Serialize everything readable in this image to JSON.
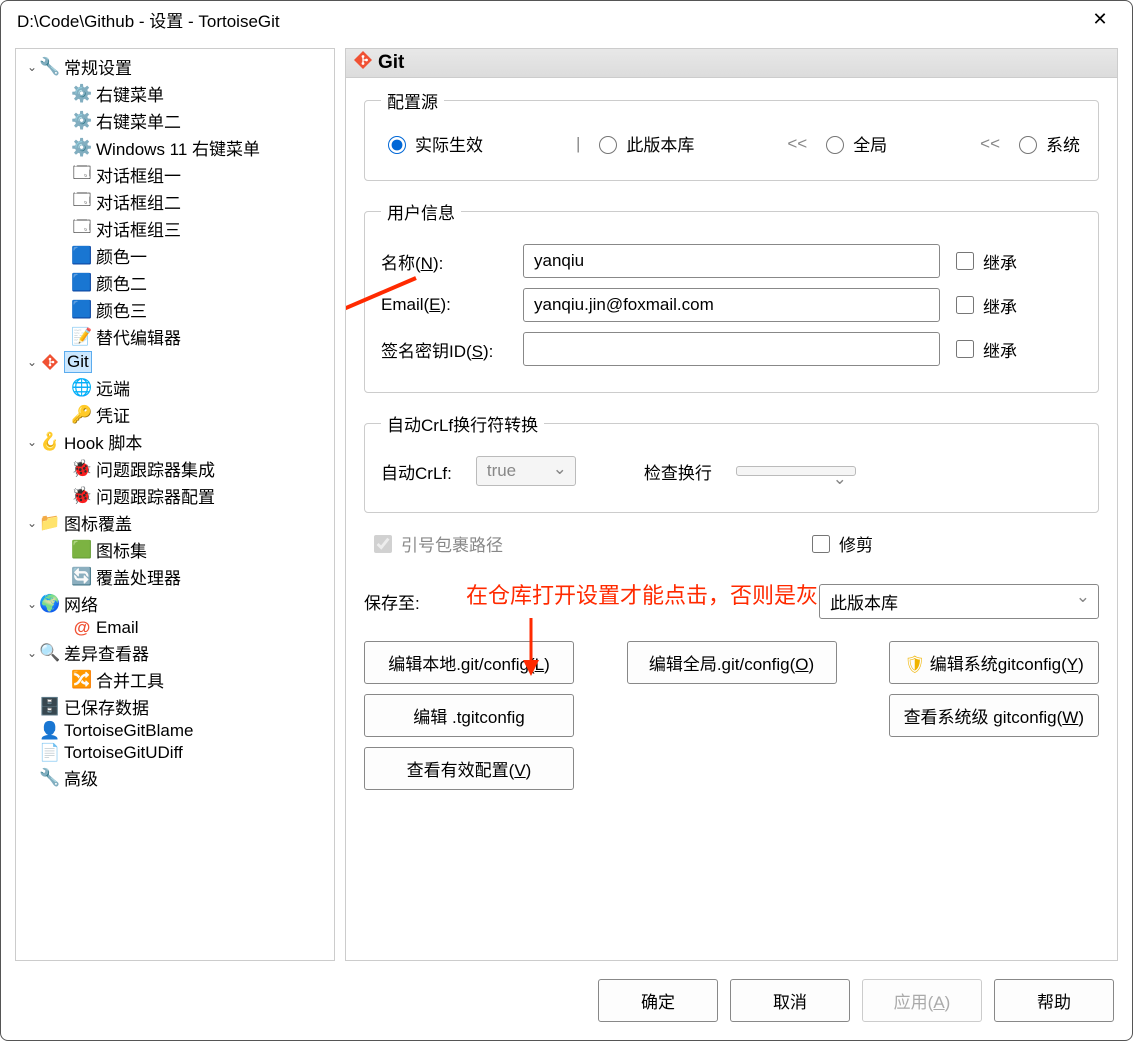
{
  "window": {
    "title": "D:\\Code\\Github - 设置 - TortoiseGit"
  },
  "tree": {
    "general": {
      "label": "常规设置",
      "children": {
        "ctx1": "右键菜单",
        "ctx2": "右键菜单二",
        "win11": "Windows 11 右键菜单",
        "dlg1": "对话框组一",
        "dlg2": "对话框组二",
        "dlg3": "对话框组三",
        "col1": "颜色一",
        "col2": "颜色二",
        "col3": "颜色三",
        "editor": "替代编辑器"
      }
    },
    "git": {
      "label": "Git",
      "children": {
        "remote": "远端",
        "cred": "凭证"
      }
    },
    "hook": {
      "label": "Hook 脚本",
      "children": {
        "issue_int": "问题跟踪器集成",
        "issue_cfg": "问题跟踪器配置"
      }
    },
    "overlay": {
      "label": "图标覆盖",
      "children": {
        "iconset": "图标集",
        "handler": "覆盖处理器"
      }
    },
    "network": {
      "label": "网络",
      "children": {
        "email": "Email"
      }
    },
    "diff": {
      "label": "差异查看器",
      "children": {
        "merge": "合并工具"
      }
    },
    "saved": {
      "label": "已保存数据"
    },
    "blame": {
      "label": "TortoiseGitBlame"
    },
    "udiff": {
      "label": "TortoiseGitUDiff"
    },
    "advanced": {
      "label": "高级"
    }
  },
  "panel": {
    "title": "Git"
  },
  "config_source": {
    "legend": "配置源",
    "effective": "实际生效",
    "local": "此版本库",
    "global": "全局",
    "system": "系统",
    "lt1": "<<",
    "lt2": "<<",
    "bar": "|"
  },
  "user_info": {
    "legend": "用户信息",
    "name_label": "名称(N):",
    "name_value": "yanqiu",
    "email_label": "Email(E):",
    "email_value": "yanqiu.jin@foxmail.com",
    "sign_label": "签名密钥ID(S):",
    "sign_value": "",
    "inherit": "继承"
  },
  "crlf": {
    "legend": "自动CrLf换行符转换",
    "auto_label": "自动CrLf:",
    "auto_value": "true",
    "check_label": "检查换行",
    "check_value": ""
  },
  "misc": {
    "quote_path": "引号包裹路径",
    "trim": "修剪",
    "save_to": "保存至:",
    "save_to_value": "此版本库"
  },
  "buttons": {
    "edit_local": "编辑本地.git/config(L)",
    "edit_global": "编辑全局.git/config(O)",
    "edit_system": "编辑系统gitconfig(Y)",
    "edit_tgit": "编辑 .tgitconfig",
    "view_sys": "查看系统级 gitconfig(W)",
    "view_eff": "查看有效配置(V)"
  },
  "annotation": "在仓库打开设置才能点击，否则是灰的",
  "footer": {
    "ok": "确定",
    "cancel": "取消",
    "apply": "应用(A)",
    "help": "帮助"
  }
}
